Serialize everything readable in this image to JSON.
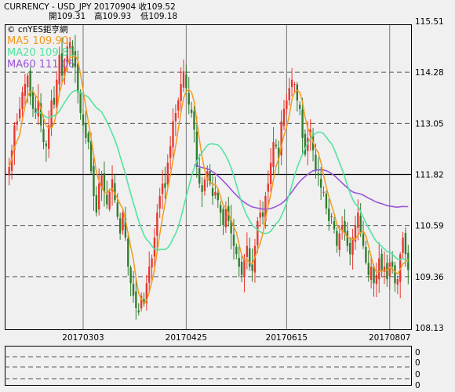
{
  "header": {
    "line1": "CURRENCY - USD_JPY    20170904   收109.52",
    "open_label": "開109.31",
    "high_label": "高109.93",
    "low_label": "低109.18"
  },
  "logo": "© cnYES鉅亨網",
  "colors": {
    "up": "#e8372e",
    "down": "#2f7d2f",
    "ma5": "#f39a1e",
    "ma20": "#55e3a0",
    "ma60": "#9a55d8",
    "grid": "#555555"
  },
  "chart_data": {
    "type": "candlestick",
    "y_ticks": [
      "115.51",
      "114.28",
      "113.05",
      "111.82",
      "110.59",
      "109.36",
      "108.13"
    ],
    "ylim": [
      108.13,
      115.51
    ],
    "x_ticks": [
      "20170303",
      "20170425",
      "20170615",
      "20170807"
    ],
    "legend": [
      {
        "key": "ma5",
        "text": "MA5 109.90"
      },
      {
        "key": "ma20",
        "text": "MA20 109.81"
      },
      {
        "key": "ma60",
        "text": "MA60 111.06"
      }
    ],
    "sub_panel_labels": [
      "0",
      "0",
      "0",
      "0"
    ],
    "close": [
      112.0,
      112.4,
      113.0,
      113.1,
      113.4,
      113.8,
      114.0,
      114.2,
      113.7,
      113.4,
      113.3,
      113.6,
      113.0,
      112.6,
      112.5,
      113.0,
      113.6,
      113.5,
      114.1,
      114.7,
      114.2,
      114.4,
      114.9,
      115.0,
      114.7,
      114.4,
      113.8,
      113.3,
      113.0,
      112.7,
      112.6,
      111.9,
      111.3,
      110.9,
      111.6,
      111.8,
      111.4,
      111.1,
      111.4,
      111.7,
      111.2,
      110.8,
      110.4,
      110.9,
      110.3,
      109.6,
      109.2,
      108.9,
      108.6,
      108.5,
      108.9,
      108.7,
      109.2,
      109.6,
      109.8,
      110.3,
      110.9,
      111.3,
      111.6,
      111.5,
      112.1,
      112.5,
      113.1,
      113.3,
      113.6,
      114.0,
      114.3,
      113.9,
      113.5,
      113.3,
      112.9,
      112.0,
      111.6,
      111.4,
      111.7,
      111.9,
      111.6,
      111.3,
      111.4,
      111.2,
      110.9,
      110.6,
      111.0,
      110.7,
      110.4,
      110.1,
      109.9,
      109.6,
      109.4,
      109.8,
      110.1,
      109.6,
      109.5,
      110.1,
      110.7,
      110.9,
      110.8,
      111.3,
      111.6,
      112.1,
      112.6,
      112.5,
      112.2,
      113.1,
      113.4,
      113.6,
      113.9,
      114.1,
      114.0,
      113.6,
      113.4,
      112.7,
      112.3,
      112.7,
      112.9,
      112.4,
      111.9,
      111.8,
      111.5,
      111.4,
      111.0,
      110.7,
      110.8,
      110.5,
      110.1,
      110.4,
      110.6,
      110.4,
      110.1,
      109.9,
      110.3,
      110.6,
      110.9,
      110.4,
      110.1,
      109.7,
      109.4,
      109.6,
      109.2,
      109.4,
      109.8,
      109.5,
      109.6,
      109.3,
      109.7,
      109.6,
      109.2,
      109.3,
      109.9,
      110.3,
      109.9,
      109.52
    ],
    "ma60_start_index": 70,
    "ma60_last": 111.06
  }
}
